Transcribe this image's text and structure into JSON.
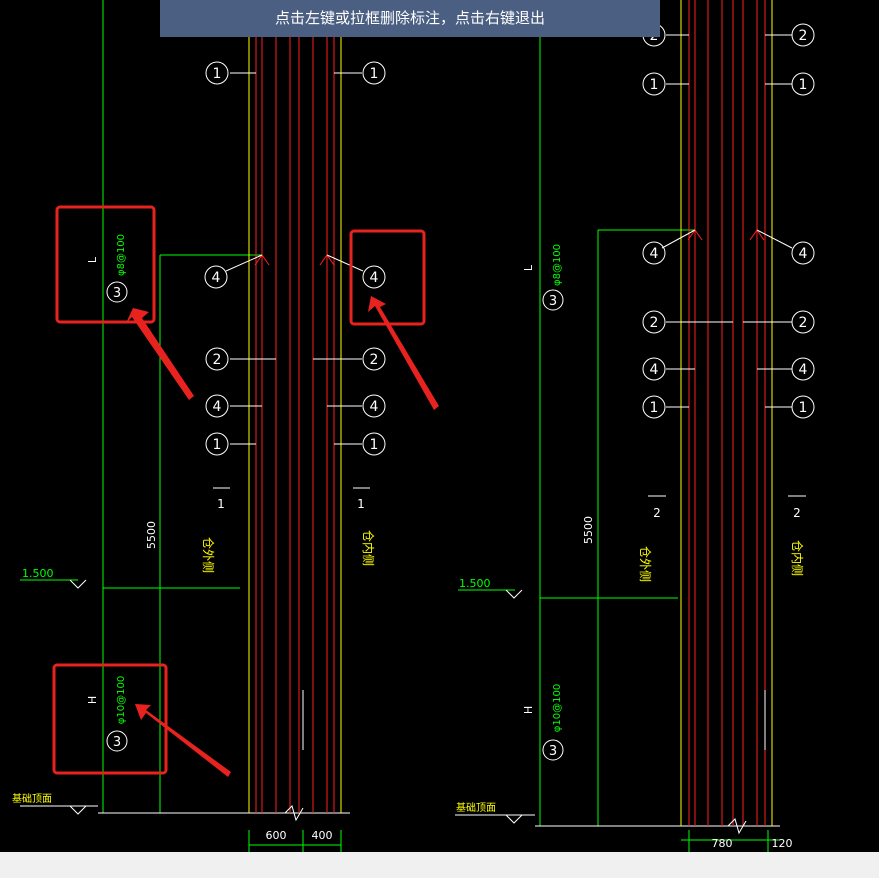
{
  "hint": {
    "text": "点击左键或拉框删除标注，点击右键退出"
  },
  "colors": {
    "background": "#000000",
    "red": "#ff2020",
    "yellow": "#ffff00",
    "green": "#00ff00",
    "white": "#ffffff",
    "callout": "#e8231f",
    "hint_bg": "#4a5f82",
    "statusbar": "#f0f0f0"
  },
  "markers": {
    "m1": "1",
    "m2": "2",
    "m3": "3",
    "m4": "4"
  },
  "left_drawing": {
    "span_label": "L",
    "span_rebar": "φ8@100",
    "height_label": "H",
    "height_rebar": "φ10@100",
    "section_mark": "1",
    "dimension_height": "5500",
    "outer_side": "仓外侧",
    "inner_side": "仓内侧",
    "elevation": "1.500",
    "foundation_top": "基础顶面",
    "dim_left": "600",
    "dim_right": "400"
  },
  "right_drawing": {
    "span_label": "L",
    "span_rebar": "φ8@100",
    "height_label": "H",
    "height_rebar": "φ10@100",
    "section_mark": "2",
    "dimension_height": "5500",
    "outer_side": "仓外侧",
    "inner_side": "仓内侧",
    "elevation": "1.500",
    "foundation_top": "基础顶面",
    "dim_left": "780",
    "dim_right": "120"
  }
}
